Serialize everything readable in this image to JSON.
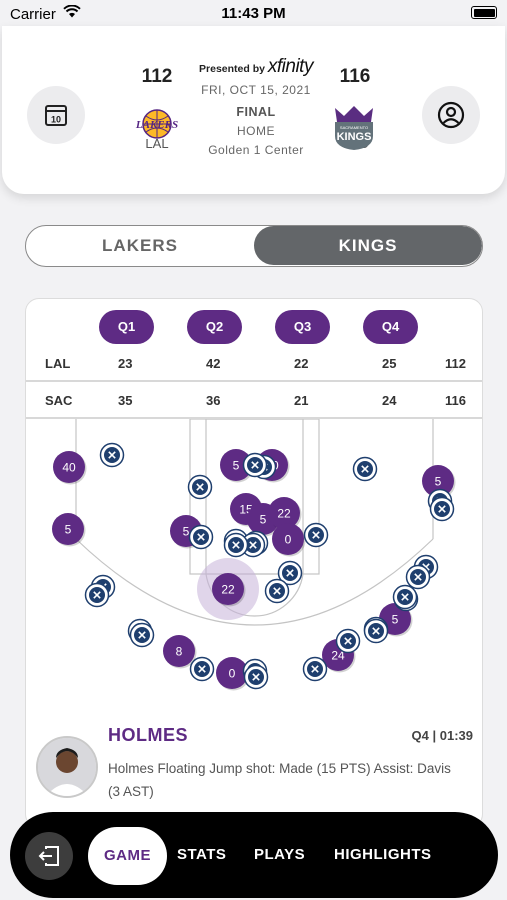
{
  "status_bar": {
    "carrier": "Carrier",
    "time": "11:43 PM"
  },
  "header": {
    "presented_by": "Presented by",
    "sponsor": "xfinity",
    "date": "FRI, OCT 15, 2021",
    "status": "FINAL",
    "venue_type": "HOME",
    "arena": "Golden 1 Center",
    "calendar_day": "10",
    "away": {
      "abbr": "LAL",
      "score": "112",
      "logo_text": "LAKERS"
    },
    "home": {
      "abbr": "SAC",
      "score": "116",
      "logo_text": "KINGS",
      "logo_subtext": "SACRAMENTO"
    }
  },
  "team_toggle": {
    "left": "LAKERS",
    "right": "KINGS",
    "selected": "KINGS"
  },
  "score_table": {
    "quarters": [
      "Q1",
      "Q2",
      "Q3",
      "Q4"
    ],
    "rows": [
      {
        "team": "LAL",
        "q": [
          "23",
          "42",
          "22",
          "25"
        ],
        "total": "112"
      },
      {
        "team": "SAC",
        "q": [
          "35",
          "36",
          "21",
          "24"
        ],
        "total": "116"
      }
    ]
  },
  "shot_chart": {
    "colors": {
      "made": "#5e2b84",
      "missed": "#1f3f6e",
      "highlight": "#c7b3d9"
    },
    "made_labels": [
      "40",
      "5",
      "8",
      "0",
      "5",
      "40",
      "5",
      "15",
      "5",
      "22",
      "0",
      "22",
      "24",
      "5",
      "5"
    ],
    "missed_count": 30
  },
  "last_play": {
    "player": "HOLMES",
    "clock": "Q4 | 01:39",
    "description": "Holmes Floating Jump shot: Made (15 PTS) Assist: Davis (3 AST)"
  },
  "tab_bar": {
    "back_icon": "exit-icon",
    "tabs": [
      "GAME",
      "STATS",
      "PLAYS",
      "HIGHLIGHTS"
    ],
    "active": "GAME"
  }
}
